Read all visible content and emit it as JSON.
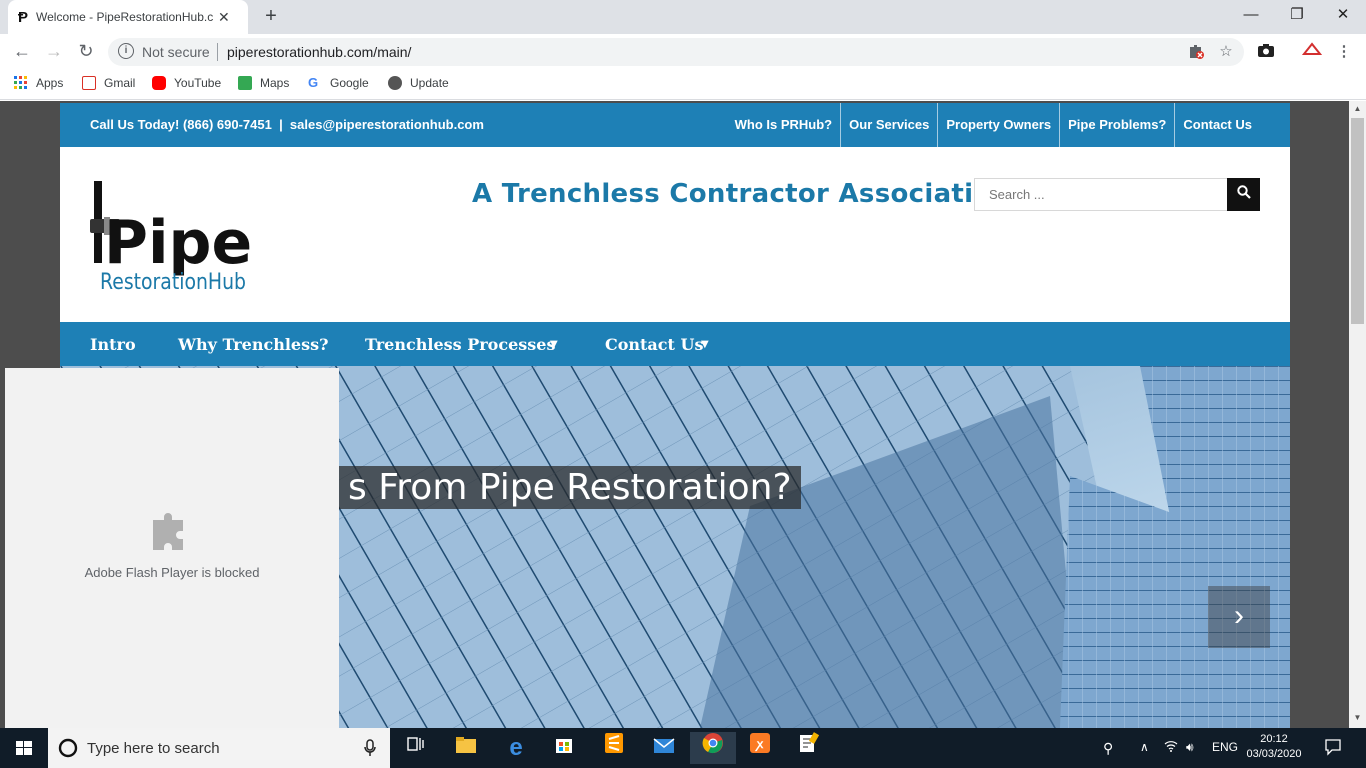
{
  "browser": {
    "tab_title": "Welcome - PipeRestorationHub.c",
    "tab_close": "✕",
    "new_tab": "+",
    "omnibox_security": "Not secure",
    "omnibox_url": "piperestorationhub.com/main/",
    "bookmarks": [
      {
        "label": "Apps",
        "icon": "apps-grid-icon"
      },
      {
        "label": "Gmail",
        "icon": "gmail-icon"
      },
      {
        "label": "YouTube",
        "icon": "youtube-icon"
      },
      {
        "label": "Maps",
        "icon": "maps-icon"
      },
      {
        "label": "Google",
        "icon": "google-icon"
      },
      {
        "label": "Update",
        "icon": "globe-icon"
      }
    ]
  },
  "site": {
    "topbar_contact": "Call Us Today! (866) 690-7451  |  sales@piperestorationhub.com",
    "topnav": [
      "Who Is PRHub?",
      "Our Services",
      "Property Owners",
      "Pipe Problems?",
      "Contact Us"
    ],
    "logo_text_top": "Pipe",
    "logo_text_bottom": "RestorationHub",
    "tagline": "A Trenchless Contractor Association",
    "search_placeholder": "Search ...",
    "mainnav": [
      "Intro",
      "Why Trenchless?",
      "Trenchless Processes",
      "Contact Us"
    ],
    "hero_caption": "s From Pipe Restoration?",
    "next_arrow": "›"
  },
  "flash": {
    "message": "Adobe Flash Player is blocked"
  },
  "taskbar": {
    "search_placeholder": "Type here to search",
    "time": "20:12",
    "date": "03/03/2020",
    "language": "ENG"
  },
  "colors": {
    "site_blue": "#1e80b6",
    "tagline_blue": "#1b79a8",
    "taskbar": "#101c28"
  }
}
